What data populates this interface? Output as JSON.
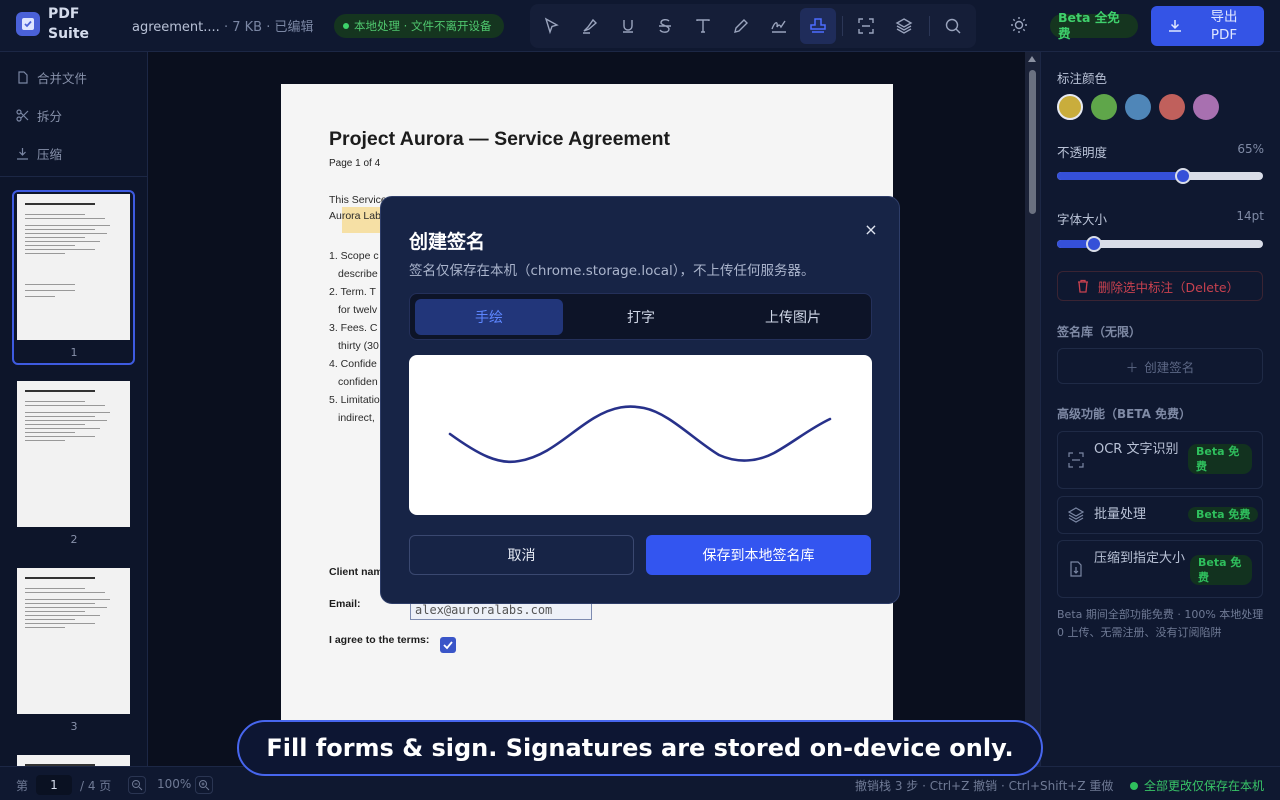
{
  "app": {
    "name": "PDF Suite"
  },
  "file": {
    "name": "agreement....",
    "meta": " · 7 KB · 已编辑"
  },
  "local_pill": "本地处理 · 文件不离开设备",
  "beta_pill": "Beta 全免费",
  "export_label": "导出 PDF",
  "toolbar": {
    "icons": [
      "select-icon",
      "highlight-icon",
      "underline-icon",
      "strikethrough-icon",
      "text-icon",
      "pen-icon",
      "signature-icon",
      "stamp-icon",
      "ocr-icon",
      "layers-icon",
      "search-icon"
    ],
    "active": "stamp-icon"
  },
  "sidebar": {
    "nav": [
      {
        "label": "合并文件",
        "icon": "merge-icon"
      },
      {
        "label": "拆分",
        "icon": "scissors-icon"
      },
      {
        "label": "压缩",
        "icon": "compress-icon"
      }
    ],
    "pages": [
      "1",
      "2",
      "3"
    ]
  },
  "document": {
    "title": "Project Aurora — Service Agreement",
    "subtitle": "Page 1 of 4",
    "lines": [
      "This Service",
      "Aurora Lab",
      "1. Scope c",
      "   describe",
      "2. Term. T",
      "   for twelv",
      "3. Fees. C",
      "   thirty (30",
      "4. Confide",
      "   confiden",
      "5. Limitatio",
      "   indirect,"
    ],
    "client_label": "Client nam",
    "email_label": "Email:",
    "email_value": "alex@auroralabs.com",
    "agree_label": "I agree to the terms:"
  },
  "right": {
    "color_label": "标注颜色",
    "colors": [
      "#c9ad3c",
      "#5fa64a",
      "#4f86b8",
      "#c0605c",
      "#a870b0"
    ],
    "opacity_label": "不透明度",
    "opacity_value": "65%",
    "opacity_fraction": 0.61,
    "fontsize_label": "字体大小",
    "fontsize_value": "14pt",
    "fontsize_fraction": 0.18,
    "delete_label": "删除选中标注（Delete）",
    "library_label": "签名库（无限）",
    "create_sig_label": "创建签名",
    "advanced_label": "高级功能（BETA 免费）",
    "features": [
      {
        "label": "OCR 文字识别",
        "badge": "Beta 免费",
        "icon": "ocr-icon"
      },
      {
        "label": "批量处理",
        "badge": "Beta 免费",
        "icon": "layers-icon"
      },
      {
        "label": "压缩到指定大小",
        "badge": "Beta 免费",
        "icon": "file-compress-icon"
      }
    ],
    "note": "Beta 期间全部功能免费 · 100% 本地处理 0 上传、无需注册、没有订阅陷阱"
  },
  "status": {
    "page_prefix": "第",
    "page_value": "1",
    "page_total": "/ 4 页",
    "zoom": "100%",
    "undo": "撤销栈 3 步 · Ctrl+Z 撤销 · Ctrl+Shift+Z 重做",
    "saved": "全部更改仅保存在本机"
  },
  "modal": {
    "title": "创建签名",
    "subtitle": "签名仅保存在本机（chrome.storage.local），不上传任何服务器。",
    "close": "×",
    "tabs": [
      "手绘",
      "打字",
      "上传图片"
    ],
    "active_tab": "手绘",
    "cancel": "取消",
    "save": "保存到本地签名库"
  },
  "banner": "Fill forms & sign. Signatures are stored on-device only."
}
